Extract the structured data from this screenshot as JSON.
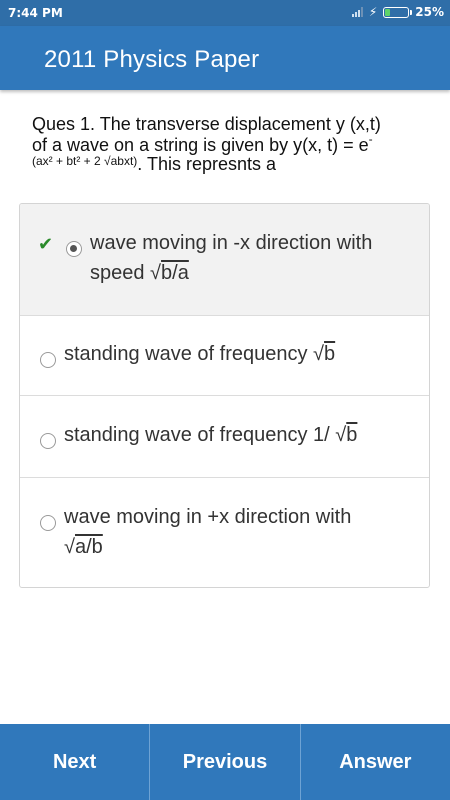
{
  "status_bar": {
    "time": "7:44 PM",
    "battery_percent": "25%",
    "battery_level": 0.25
  },
  "app_bar": {
    "title": "2011 Physics Paper"
  },
  "question": {
    "line1": "Ques 1. The transverse displacement y (x,t)",
    "line2": "of a wave on a string is given by y(x, t) = e",
    "line2_sup": "-",
    "exponent": "(ax² + bt² + 2 √abxt)",
    "tail": ". This represnts a"
  },
  "options": [
    {
      "line1": "wave moving in -x direction with",
      "line2_pre": "speed √",
      "line2_ov": "b/a",
      "selected": true,
      "correct": true
    },
    {
      "line1_pre": "standing wave of frequency √",
      "line1_ov": "b",
      "selected": false
    },
    {
      "line1_pre": "standing wave of frequency 1/ √",
      "line1_ov": "b",
      "selected": false
    },
    {
      "line1": "wave moving in +x direction with",
      "line2_pre": "√",
      "line2_ov": "a/b",
      "selected": false
    }
  ],
  "bottom_bar": {
    "next_label": "Next",
    "previous_label": "Previous",
    "answer_label": "Answer"
  }
}
